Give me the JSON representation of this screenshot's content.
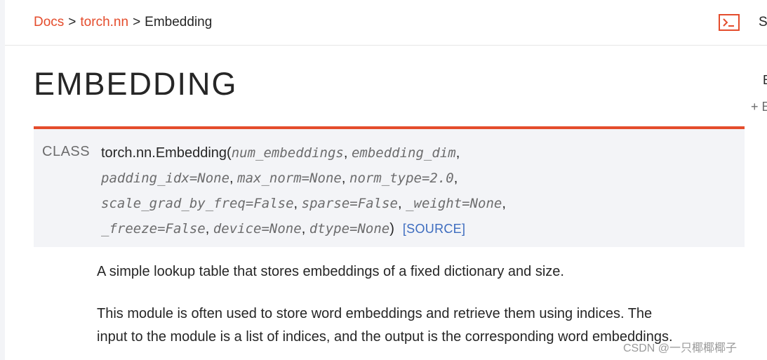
{
  "breadcrumb": {
    "items": [
      "Docs",
      "torch.nn"
    ],
    "separator": ">",
    "current": "Embedding"
  },
  "header": {
    "cut_right_text": "S"
  },
  "sidebar_right": {
    "cut_text_1": "E",
    "cut_text_2": "+ E"
  },
  "page_title": "EMBEDDING",
  "class_block": {
    "label": "CLASS",
    "name": "torch.nn.Embedding",
    "open_paren": "(",
    "close_paren": ")",
    "params": [
      "num_embeddings",
      "embedding_dim",
      "padding_idx=None",
      "max_norm=None",
      "norm_type=2.0",
      "scale_grad_by_freq=False",
      "sparse=False",
      "_weight=None",
      "_freeze=False",
      "device=None",
      "dtype=None"
    ],
    "source_link": "[SOURCE]"
  },
  "description": {
    "p1": "A simple lookup table that stores embeddings of a fixed dictionary and size.",
    "p2_line1": "This module is often used to store word embeddings and retrieve them using indices. The",
    "p2_line2": "input to the module is a list of indices, and the output is the corresponding word embeddings."
  },
  "watermark": "CSDN @一只椰椰椰子",
  "colors": {
    "accent": "#e44c2c",
    "link_blue": "#3d6cbf",
    "block_bg": "#f3f4f7",
    "text": "#262626",
    "muted": "#6c6c6d"
  },
  "icons": {
    "terminal": "terminal-icon"
  }
}
